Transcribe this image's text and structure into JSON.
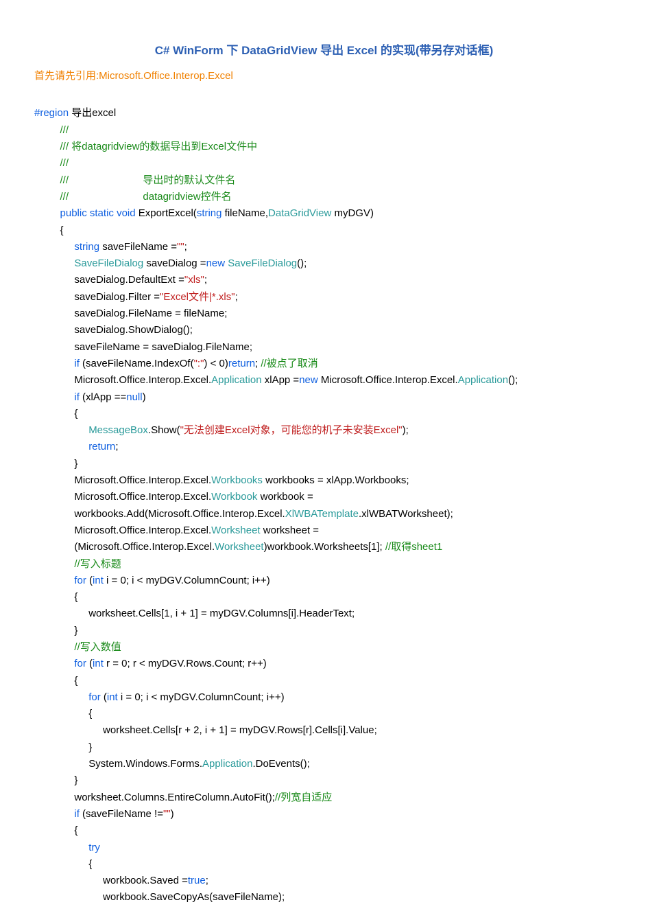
{
  "title": "C# WinForm 下 DataGridView 导出 Excel 的实现(带另存对话框)",
  "intro": "首先请先引用:Microsoft.Office.Interop.Excel",
  "kw": {
    "region": "#region",
    "public": "public",
    "static": "static",
    "void": "void",
    "string_t": "string",
    "new": "new",
    "if": "if",
    "null": "null",
    "return": "return",
    "for": "for",
    "int": "int",
    "true": "true",
    "try": "try"
  },
  "ty": {
    "SaveFileDialog": "SaveFileDialog",
    "SaveFileDialog2": "SaveFileDialog",
    "DataGridView": "DataGridView",
    "Application": "Application",
    "Application2": "Application",
    "Application3": "Application",
    "MessageBox": "MessageBox",
    "Workbooks": "Workbooks",
    "Workbook": "Workbook",
    "XlWBATemplate": "XlWBATemplate",
    "Worksheet": "Worksheet",
    "Worksheet2": "Worksheet"
  },
  "cm": {
    "summary1": "///",
    "summary2": "/// 将datagridview的数据导出到Excel文件中",
    "summary3": "///",
    "param1a": "///",
    "param1b": "导出时的默认文件名",
    "param2a": "///",
    "param2b": "datagridview控件名",
    "cancel": "//被点了取消",
    "sheet1": "//取得sheet1",
    "titles": "//写入标题",
    "values": "//写入数值",
    "autofit": "//列宽自适应"
  },
  "str": {
    "empty": "\"\"",
    "xls": "\"xls\"",
    "filter": "\"Excel文件|*.xls\"",
    "colon": "\":\"",
    "msgbox": "\"无法创建Excel对象，可能您的机子未安装Excel\"",
    "empty2": "\"\""
  },
  "txt": {
    "region_label": " 导出excel",
    "method_sig_pre": " ExportExcel(",
    "method_sig_mid": " fileName,",
    "method_sig_post": " myDGV)",
    "lbrace": "{",
    "rbrace": "}",
    "saveFileName_decl": " saveFileName =",
    "semicolon": ";",
    "saveDialog_decl": " saveDialog =",
    "sfd_ctor": "();",
    "defaultExt": "saveDialog.DefaultExt =",
    "filter": "saveDialog.Filter =",
    "fileNameAssign": "saveDialog.FileName = fileName;",
    "showDialog": "saveDialog.ShowDialog();",
    "saveFileNameAssign": "saveFileName = saveDialog.FileName;",
    "if_indexOf": " (saveFileName.IndexOf(",
    "if_indexOf_post": ") < 0)",
    "return_semi": "; ",
    "excel_app_pre": "Microsoft.Office.Interop.Excel.",
    "excel_app_mid": " xlApp =",
    "excel_app_post": " Microsoft.Office.Interop.Excel.",
    "app_ctor": "();",
    "if_xlapp": " (xlApp ==",
    "if_close": ")",
    "msg_show": ".Show(",
    "msg_close": ");",
    "return2": ";",
    "workbooks_pre": "Microsoft.Office.Interop.Excel.",
    "workbooks_post": " workbooks = xlApp.Workbooks;",
    "workbook_pre": "Microsoft.Office.Interop.Excel.",
    "workbook_post": " workbook =",
    "workbooks_add_pre": "workbooks.Add(Microsoft.Office.Interop.Excel.",
    "workbooks_add_post": ".xlWBATWorksheet);",
    "worksheet_pre": "Microsoft.Office.Interop.Excel.",
    "worksheet_post": " worksheet =",
    "worksheet_cast_pre": "(Microsoft.Office.Interop.Excel.",
    "worksheet_cast_post": ")workbook.Worksheets[1]; ",
    "for1": " (",
    "for1_body": " i = 0; i < myDGV.ColumnCount; i++)",
    "for1_inner": "worksheet.Cells[1, i + 1] = myDGV.Columns[i].HeaderText;",
    "for2": " (",
    "for2_body": " r = 0; r < myDGV.Rows.Count; r++)",
    "for3": " (",
    "for3_body": " i = 0; i < myDGV.ColumnCount; i++)",
    "for3_inner": "worksheet.Cells[r + 2, i + 1] = myDGV.Rows[r].Cells[i].Value;",
    "doevents_pre": "System.Windows.Forms.",
    "doevents_post": ".DoEvents();",
    "autofit_call": "worksheet.Columns.EntireColumn.AutoFit();",
    "if_save": " (saveFileName !=",
    "saved_pre": "workbook.Saved =",
    "saved_post": ";",
    "savecopy": "workbook.SaveCopyAs(saveFileName);"
  }
}
